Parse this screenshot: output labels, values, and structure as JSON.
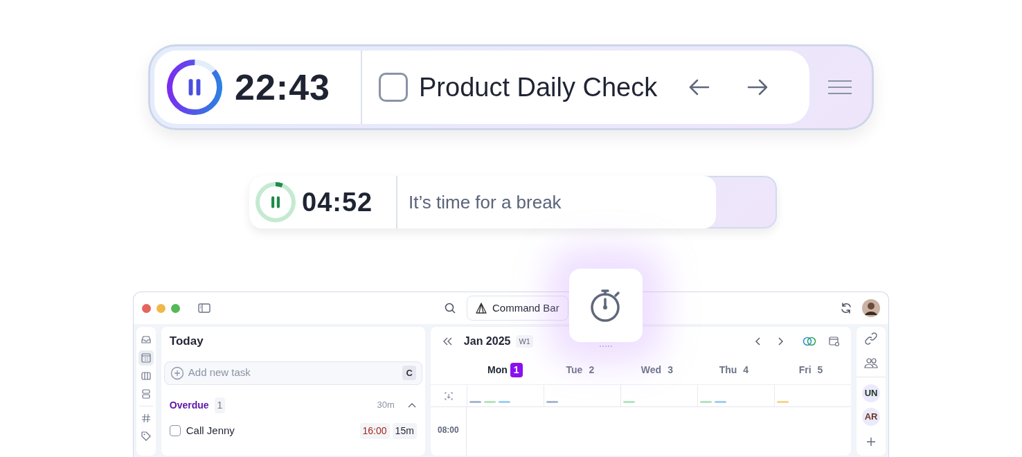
{
  "focus_bar": {
    "time": "22:43",
    "level": 0.86,
    "task": "Product Daily Check",
    "checked": false
  },
  "break_bar": {
    "time": "04:52",
    "level": 0.06,
    "message": "It’s time for a break"
  },
  "app": {
    "command_bar": "Command Bar",
    "nav": [
      {
        "kind": "inbox",
        "selected": false
      },
      {
        "kind": "calendar",
        "selected": true
      },
      {
        "kind": "columns",
        "selected": false
      },
      {
        "kind": "rows",
        "selected": false
      },
      {
        "kind": "hash",
        "selected": false
      },
      {
        "kind": "tag",
        "selected": false
      }
    ],
    "today": {
      "title": "Today",
      "add_placeholder": "Add new task",
      "shortcut": "C",
      "section": {
        "label": "Overdue",
        "count": "1",
        "duration": "30m",
        "expanded": true
      },
      "tasks": [
        {
          "name": "Call Jenny",
          "checked": false,
          "time": "16:00",
          "duration": "15m"
        }
      ]
    },
    "calendar": {
      "month": "Jan 2025",
      "week": "W1",
      "days": [
        {
          "name": "Mon",
          "date": "1",
          "selected": true,
          "events": [
            {
              "color": "#a9b6cf"
            },
            {
              "color": "#b5e3c0"
            },
            {
              "color": "#9dcff2"
            }
          ]
        },
        {
          "name": "Tue",
          "date": "2",
          "selected": false,
          "events": [
            {
              "color": "#a9b6cf"
            }
          ]
        },
        {
          "name": "Wed",
          "date": "3",
          "selected": false,
          "events": [
            {
              "color": "#b5e3c0"
            }
          ]
        },
        {
          "name": "Thu",
          "date": "4",
          "selected": false,
          "events": [
            {
              "color": "#b5e3c0"
            },
            {
              "color": "#9dcff2"
            }
          ]
        },
        {
          "name": "Fri",
          "date": "5",
          "selected": false,
          "events": [
            {
              "color": "#f4d68e"
            }
          ]
        }
      ],
      "times": [
        "08:00"
      ]
    },
    "people": [
      {
        "initials": "UN",
        "color": "#1e3326"
      },
      {
        "initials": "AR",
        "color": "#6b3420"
      }
    ]
  }
}
